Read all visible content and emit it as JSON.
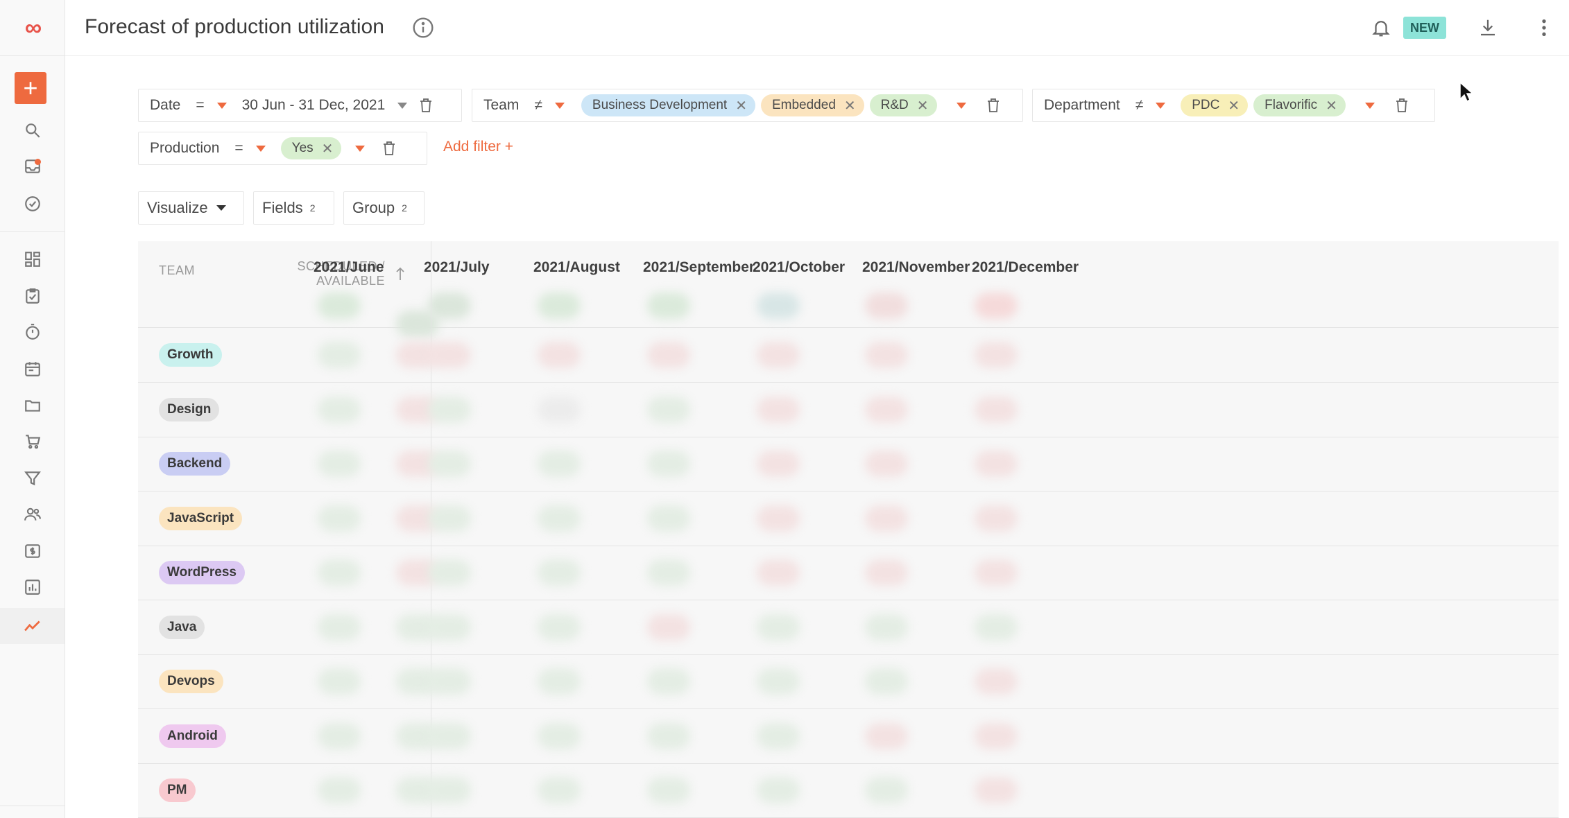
{
  "header": {
    "title": "Forecast of production utilization",
    "new_badge": "NEW"
  },
  "sidebar": {
    "logo": "∞",
    "add_label": "+",
    "items": [
      {
        "icon": "search-icon"
      },
      {
        "icon": "inbox-icon"
      },
      {
        "icon": "check-circle-icon"
      },
      {
        "icon": "dashboard-icon"
      },
      {
        "icon": "tasks-icon"
      },
      {
        "icon": "timer-icon"
      },
      {
        "icon": "calendar-icon"
      },
      {
        "icon": "folder-icon"
      },
      {
        "icon": "cart-icon"
      },
      {
        "icon": "funnel-icon"
      },
      {
        "icon": "people-icon"
      },
      {
        "icon": "invoice-icon"
      },
      {
        "icon": "report-icon"
      },
      {
        "icon": "trend-icon"
      }
    ]
  },
  "filters": {
    "date": {
      "label": "Date",
      "op": "=",
      "value": "30 Jun - 31 Dec, 2021"
    },
    "team": {
      "label": "Team",
      "op": "≠",
      "chips": [
        "Business Development",
        "Embedded",
        "R&D"
      ]
    },
    "department": {
      "label": "Department",
      "op": "≠",
      "chips": [
        "PDC",
        "Flavorific"
      ]
    },
    "production": {
      "label": "Production",
      "op": "=",
      "chips": [
        "Yes"
      ]
    },
    "add_filter": "Add filter +"
  },
  "view": {
    "visualize": "Visualize",
    "fields": "Fields",
    "fields_count": "2",
    "group": "Group",
    "group_count": "2"
  },
  "table": {
    "col_team": "TEAM",
    "col_sched_line1": "SCHEDULED /",
    "col_sched_line2": "AVAILABLE",
    "months": [
      "2021/June",
      "2021/July",
      "2021/August",
      "2021/September",
      "2021/October",
      "2021/November",
      "2021/December"
    ],
    "rows": [
      {
        "team": "Growth",
        "color": "#c9f1ee"
      },
      {
        "team": "Design",
        "color": "#e2e2e2"
      },
      {
        "team": "Backend",
        "color": "#c9cdf3"
      },
      {
        "team": "JavaScript",
        "color": "#fbe4bf"
      },
      {
        "team": "WordPress",
        "color": "#dcc9f3"
      },
      {
        "team": "Java",
        "color": "#e2e2e2"
      },
      {
        "team": "Devops",
        "color": "#fbe4bf"
      },
      {
        "team": "Android",
        "color": "#efc9ef"
      },
      {
        "team": "PM",
        "color": "#f8c9cf"
      }
    ]
  },
  "colors": {
    "accent": "#ee6a3f",
    "chip_blue": "#cde6f7",
    "chip_orange": "#fbe4bf",
    "chip_green": "#d8efcf",
    "chip_yellow": "#f8efb8"
  }
}
